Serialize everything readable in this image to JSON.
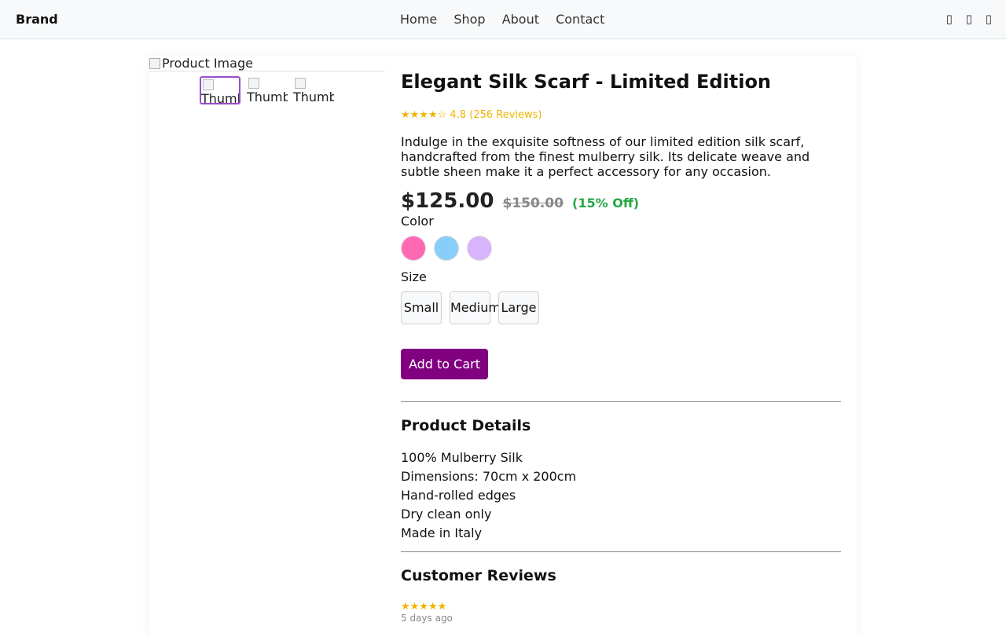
{
  "header": {
    "brand": "Brand",
    "nav": [
      "Home",
      "Shop",
      "About",
      "Contact"
    ],
    "icons": [
      "search-icon",
      "user-icon",
      "cart-icon"
    ]
  },
  "gallery": {
    "main_alt": "Product Image",
    "thumb_alt": "Thumbnail"
  },
  "product": {
    "title": "Elegant Silk Scarf - Limited Edition",
    "rating_stars": "★★★★☆",
    "rating_value": "4.8",
    "review_count_text": "(256 Reviews)",
    "description": "Indulge in the exquisite softness of our limited edition silk scarf, handcrafted from the finest mulberry silk. Its delicate weave and subtle sheen make it a perfect accessory for any occasion.",
    "price": "$125.00",
    "original_price": "$150.00",
    "discount": "(15% Off)",
    "color_label": "Color",
    "colors": [
      "#ff69b4",
      "#87cefa",
      "#d8b4fe"
    ],
    "size_label": "Size",
    "sizes": [
      "Small",
      "Medium",
      "Large"
    ],
    "add_to_cart": "Add to Cart"
  },
  "details": {
    "title": "Product Details",
    "items": [
      "100% Mulberry Silk",
      "Dimensions: 70cm x 200cm",
      "Hand-rolled edges",
      "Dry clean only",
      "Made in Italy"
    ]
  },
  "reviews": {
    "title": "Customer Reviews",
    "first": {
      "stars": "★★★★★",
      "date": "5 days ago"
    }
  },
  "colors": {
    "accent": "#800080",
    "star": "#f0b400",
    "discount": "#28a745"
  }
}
